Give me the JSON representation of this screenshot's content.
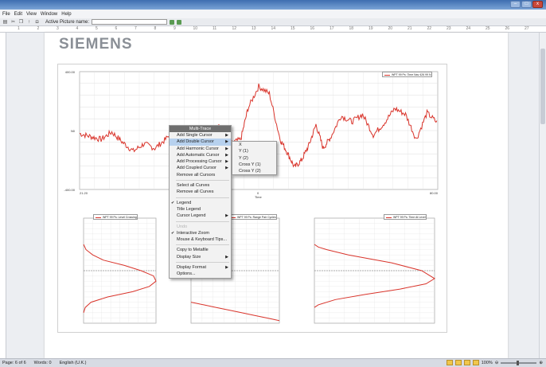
{
  "menubar": {
    "items": [
      "File",
      "Edit",
      "View",
      "Window",
      "Help"
    ]
  },
  "toolbar": {
    "active_picture_label": "Active Picture name:",
    "active_picture_value": ""
  },
  "window": {
    "controls": [
      "–",
      "□",
      "x"
    ]
  },
  "ruler": {
    "ticks": [
      "1",
      "2",
      "3",
      "4",
      "5",
      "6",
      "7",
      "8",
      "9",
      "10",
      "11",
      "12",
      "13",
      "14",
      "15",
      "16",
      "17",
      "18",
      "19",
      "20",
      "21",
      "22",
      "23",
      "24",
      "25",
      "26",
      "27"
    ]
  },
  "document": {
    "logo_text": "SIEMENS"
  },
  "context_menu": {
    "header": "Multi-Trace",
    "items": [
      {
        "label": "Add Single Cursor",
        "arrow": "▶",
        "check": "",
        "state": "normal"
      },
      {
        "label": "Add Double Cursor",
        "arrow": "▶",
        "check": "",
        "state": "highlighted"
      },
      {
        "label": "Add Harmonic Cursor",
        "arrow": "▶",
        "check": "",
        "state": "normal"
      },
      {
        "label": "Add Automatic Cursor",
        "arrow": "▶",
        "check": "",
        "state": "normal"
      },
      {
        "label": "Add Processing Cursor",
        "arrow": "▶",
        "check": "",
        "state": "normal"
      },
      {
        "label": "Add Coupled Cursor",
        "arrow": "▶",
        "check": "",
        "state": "normal"
      },
      {
        "label": "Remove all Cursors",
        "arrow": "",
        "check": "",
        "state": "normal"
      },
      {
        "sep": true
      },
      {
        "label": "Select all Curves",
        "arrow": "",
        "check": "",
        "state": "normal"
      },
      {
        "label": "Remove all Curves",
        "arrow": "",
        "check": "",
        "state": "normal"
      },
      {
        "sep": true
      },
      {
        "label": "Legend",
        "arrow": "",
        "check": "✔",
        "state": "normal"
      },
      {
        "label": "Title Legend",
        "arrow": "",
        "check": "",
        "state": "normal"
      },
      {
        "label": "Cursor Legend",
        "arrow": "▶",
        "check": "",
        "state": "normal"
      },
      {
        "sep": true
      },
      {
        "label": "Undo",
        "arrow": "",
        "check": "",
        "state": "disabled"
      },
      {
        "label": "Interactive Zoom",
        "arrow": "",
        "check": "✔",
        "state": "normal"
      },
      {
        "label": "Mouse & Keyboard Tips...",
        "arrow": "",
        "check": "",
        "state": "normal"
      },
      {
        "sep": true
      },
      {
        "label": "Copy to Metafile",
        "arrow": "",
        "check": "",
        "state": "normal"
      },
      {
        "label": "Display Size",
        "arrow": "▶",
        "check": "",
        "state": "normal"
      },
      {
        "sep": true
      },
      {
        "label": "Display Format",
        "arrow": "▶",
        "check": "",
        "state": "normal"
      },
      {
        "label": "Options...",
        "arrow": "",
        "check": "",
        "state": "normal"
      }
    ]
  },
  "submenu": {
    "items": [
      "X",
      "Y (1)",
      "Y (2)",
      "Cross Y (1)",
      "Cross Y (2)"
    ]
  },
  "status": {
    "page": "Page: 6 of 6",
    "words": "Words: 0",
    "language": "English (U.K.)",
    "zoom": "100%"
  },
  "chart_data": [
    {
      "type": "line",
      "legend": "WPT 99 Ps: Time Nav 426 99 N",
      "ylabel": "N",
      "xlabel": "Time",
      "yticks": [
        "400.00",
        "",
        "",
        "",
        "",
        "0",
        "",
        "",
        "",
        "",
        "-400.00"
      ],
      "xticks": [
        "21.20",
        "0",
        "80.00"
      ],
      "ylim": [
        -400,
        400
      ],
      "x": [
        0,
        3,
        6,
        9,
        12,
        15,
        18,
        21,
        24,
        27,
        30,
        33,
        36,
        39,
        42,
        45,
        47,
        50,
        53,
        56,
        58,
        60,
        62,
        64,
        66,
        68,
        70,
        73,
        76,
        79,
        82,
        85,
        88,
        91,
        94,
        97,
        100
      ],
      "y": [
        -20,
        -40,
        -60,
        -10,
        -80,
        -140,
        -90,
        -120,
        -60,
        20,
        -60,
        -120,
        -30,
        40,
        -90,
        -60,
        150,
        300,
        250,
        -60,
        -150,
        -250,
        -200,
        -100,
        40,
        -120,
        -50,
        100,
        60,
        110,
        -30,
        50,
        150,
        110,
        -60,
        120,
        50
      ]
    },
    {
      "type": "line",
      "legend": "WPT 99 Ps: Level Crossing",
      "x": [
        1.0,
        4,
        12,
        25,
        50,
        70,
        85,
        88,
        80,
        60,
        30,
        10,
        3,
        1.0
      ],
      "y": [
        500,
        400,
        300,
        200,
        100,
        0,
        -100,
        -200,
        -300,
        -400,
        -500,
        -600,
        -700,
        -800
      ],
      "ylim": [
        -1000,
        1000
      ]
    },
    {
      "type": "line",
      "legend": "WPT 99 Ps: Range Pair Cycles",
      "x": [
        0.001,
        0.01,
        0.1,
        1,
        10,
        100,
        1000,
        10000
      ],
      "y": [
        -600,
        -650,
        -700,
        -750,
        -800,
        -850,
        -900,
        -950
      ],
      "ylim": [
        -1000,
        1000
      ]
    },
    {
      "type": "line",
      "legend": "WPT 99 Ps: Time At Level",
      "x": [
        0.1,
        1,
        3,
        8,
        18,
        25,
        28,
        26,
        20,
        12,
        5,
        1,
        0.1
      ],
      "y": [
        500,
        450,
        400,
        300,
        150,
        0,
        -150,
        -250,
        -350,
        -450,
        -550,
        -650,
        -700
      ],
      "ylim": [
        -1000,
        1000
      ]
    }
  ]
}
